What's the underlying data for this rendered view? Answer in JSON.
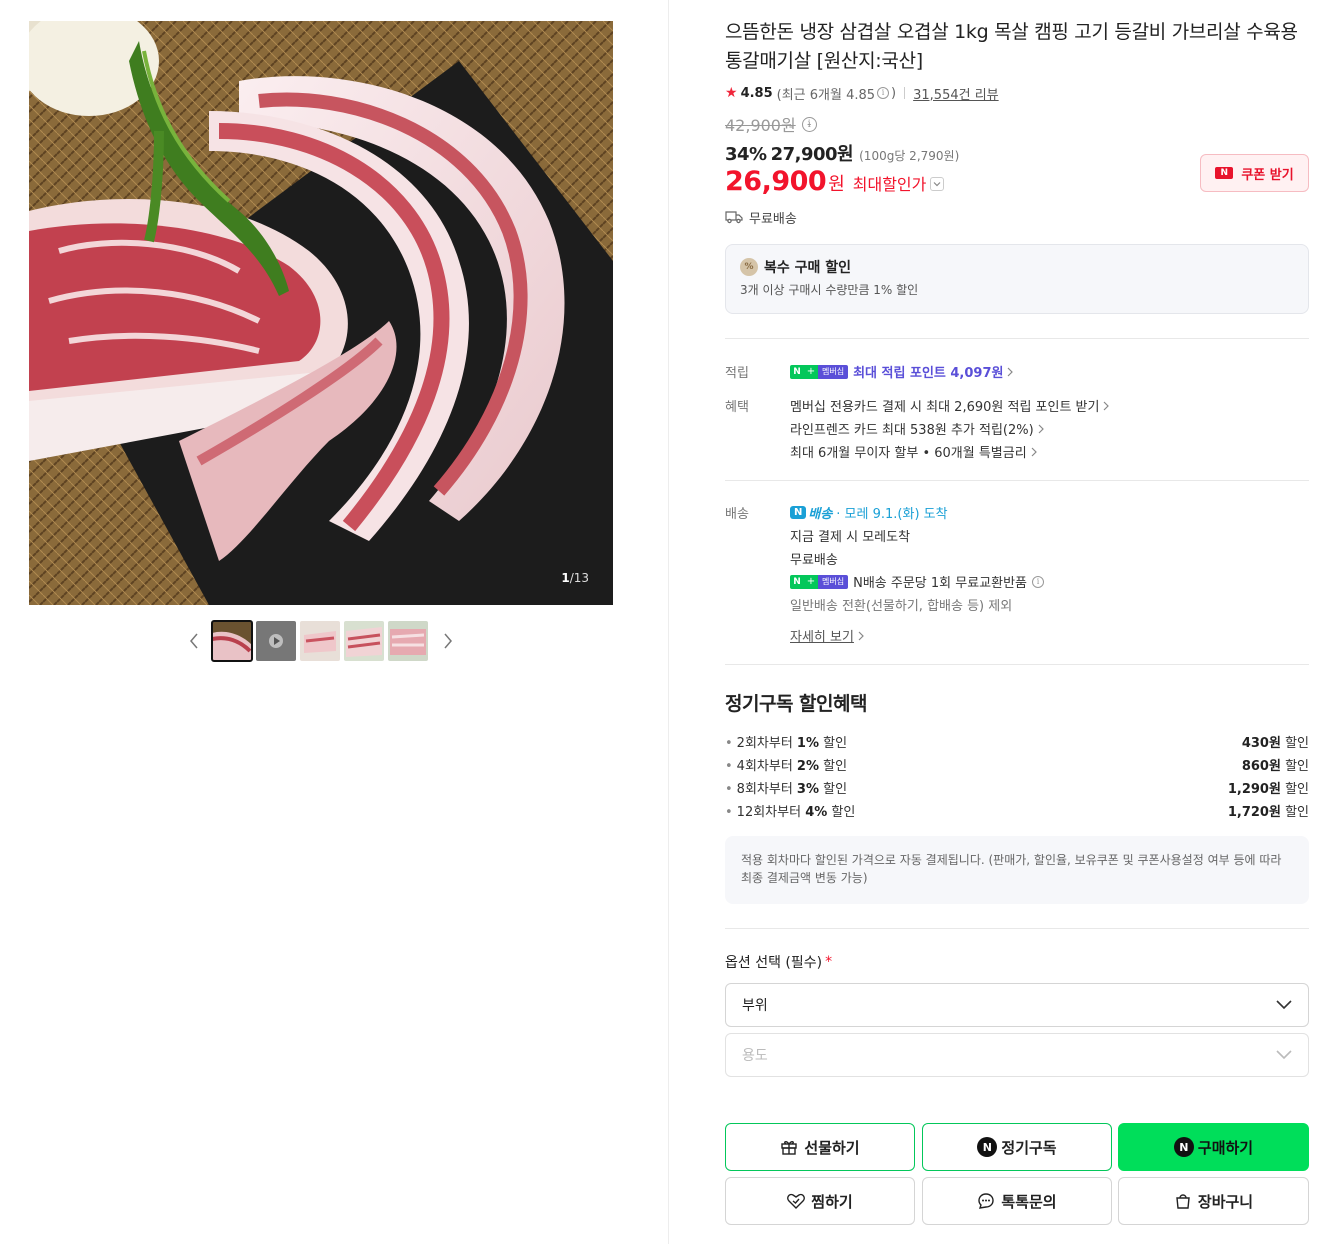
{
  "gallery": {
    "counter_current": "1",
    "counter_total": "/13",
    "thumbnail_count": 5
  },
  "product": {
    "title": "으뜸한돈 냉장 삼겹살 오겹살 1kg 목살 캠핑 고기 등갈비 가브리살 수육용 통갈매기살 [원산지:국산]",
    "rating": "4.85",
    "rating_recent": "(최근 6개월 4.85",
    "rating_close": ")",
    "review_count": "31,554건 리뷰",
    "original_price": "42,900원",
    "discount_rate": "34%",
    "sale_price": "27,900원",
    "unit_price": "(100g당 2,790원)",
    "max_discount_price": "26,900",
    "max_discount_won": "원",
    "max_discount_label": "최대할인가",
    "coupon_button": "쿠폰 받기",
    "coupon_badge": "N",
    "shipping_free": "무료배송"
  },
  "bulk": {
    "icon": "%",
    "title": "복수 구매 할인",
    "desc": "3개 이상 구매시 수량만큼 1% 할인"
  },
  "benefits": {
    "points_label": "적립",
    "points_text": "최대 적립 포인트 4,097원",
    "benefit_label": "혜택",
    "benefit_lines": [
      "멤버십 전용카드 결제 시 최대 2,690원 적립 포인트 받기",
      "라인프렌즈 카드 최대 538원 추가 적립(2%)",
      "최대 6개월 무이자 할부 • 60개월 특별금리"
    ],
    "badge_n": "N",
    "badge_plus": "+",
    "badge_member": "멤버십"
  },
  "delivery": {
    "label": "배송",
    "n_label": "배송",
    "arrival": "· 모레 9.1.(화) 도착",
    "line1": "지금 결제 시 모레도착",
    "line2": "무료배송",
    "line3": "N배송 주문당 1회 무료교환반품",
    "line4": "일반배송 전환(선물하기, 합배송 등) 제외",
    "detail_link": "자세히 보기"
  },
  "subscription": {
    "title": "정기구독 할인혜택",
    "items": [
      {
        "pre": "2회차부터 ",
        "rate": "1%",
        "post": " 할인",
        "amount": "430원",
        "suffix": " 할인"
      },
      {
        "pre": "4회차부터 ",
        "rate": "2%",
        "post": " 할인",
        "amount": "860원",
        "suffix": " 할인"
      },
      {
        "pre": "8회차부터 ",
        "rate": "3%",
        "post": " 할인",
        "amount": "1,290원",
        "suffix": " 할인"
      },
      {
        "pre": "12회차부터 ",
        "rate": "4%",
        "post": " 할인",
        "amount": "1,720원",
        "suffix": " 할인"
      }
    ],
    "note": "적용 회차마다 할인된 가격으로 자동 결제됩니다. (판매가, 할인율, 보유쿠폰 및 쿠폰사용설정 여부 등에 따라 최종 결제금액 변동 가능)"
  },
  "options": {
    "label": "옵션 선택 (필수)",
    "required_mark": "*",
    "select1": "부위",
    "select2": "용도"
  },
  "actions": {
    "gift": "선물하기",
    "subscribe": "정기구독",
    "buy": "구매하기",
    "wish": "찜하기",
    "talk": "톡톡문의",
    "cart": "장바구니",
    "n_mark": "N"
  },
  "colors": {
    "accent_red": "#f2142c",
    "naver_green": "#03c75a",
    "buy_green": "#00de5a",
    "membership_purple": "#5a4fd8",
    "delivery_blue": "#1aa0d6"
  }
}
